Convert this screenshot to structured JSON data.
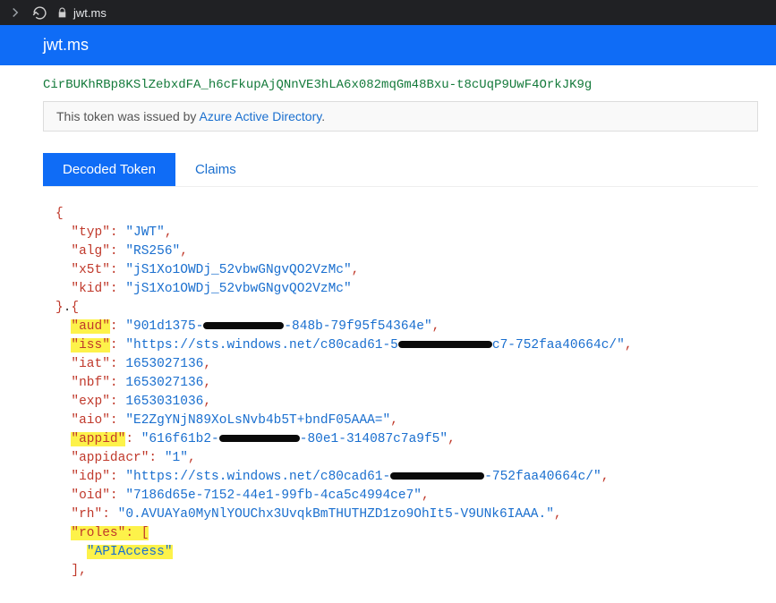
{
  "browser": {
    "url": "jwt.ms"
  },
  "header": {
    "title": "jwt.ms"
  },
  "token_raw": "CirBUKhRBp8KSlZebxdFA_h6cFkupAjQNnVE3hLA6x082mqGm48Bxu-t8cUqP9UwF4OrkJK9g",
  "issuer_notice": {
    "prefix": "This token was issued by ",
    "link_text": "Azure Active Directory",
    "suffix": "."
  },
  "tabs": {
    "decoded": "Decoded Token",
    "claims": "Claims"
  },
  "json": {
    "typ_k": "\"typ\"",
    "typ_v": "\"JWT\"",
    "alg_k": "\"alg\"",
    "alg_v": "\"RS256\"",
    "x5t_k": "\"x5t\"",
    "x5t_v": "\"jS1Xo1OWDj_52vbwGNgvQO2VzMc\"",
    "kid_k": "\"kid\"",
    "kid_v": "\"jS1Xo1OWDj_52vbwGNgvQO2VzMc\"",
    "aud_k": "\"aud\"",
    "aud_v1": "\"901d1375-",
    "aud_v2": "-848b-79f95f54364e\"",
    "iss_k": "\"iss\"",
    "iss_v1": "\"https://sts.windows.net/c80cad61-5",
    "iss_v2": "c7-752faa40664c/\"",
    "iat_k": "\"iat\"",
    "iat_v": "1653027136",
    "nbf_k": "\"nbf\"",
    "nbf_v": "1653027136",
    "exp_k": "\"exp\"",
    "exp_v": "1653031036",
    "aio_k": "\"aio\"",
    "aio_v": "\"E2ZgYNjN89XoLsNvb4b5T+bndF05AAA=\"",
    "appid_k": "\"appid\"",
    "appid_v1": "\"616f61b2-",
    "appid_v2": "-80e1-314087c7a9f5\"",
    "appidacr_k": "\"appidacr\"",
    "appidacr_v": "\"1\"",
    "idp_k": "\"idp\"",
    "idp_v1": "\"https://sts.windows.net/c80cad61-",
    "idp_v2": "-752faa40664c/\"",
    "oid_k": "\"oid\"",
    "oid_v": "\"7186d65e-7152-44e1-99fb-4ca5c4994ce7\"",
    "rh_k": "\"rh\"",
    "rh_v": "\"0.AVUAYa0MyNlYOUChx3UvqkBmTHUTHZD1zo9OhIt5-V9UNk6IAAA.\"",
    "roles_k": "\"roles\"",
    "roles_item": "\"APIAccess\""
  }
}
